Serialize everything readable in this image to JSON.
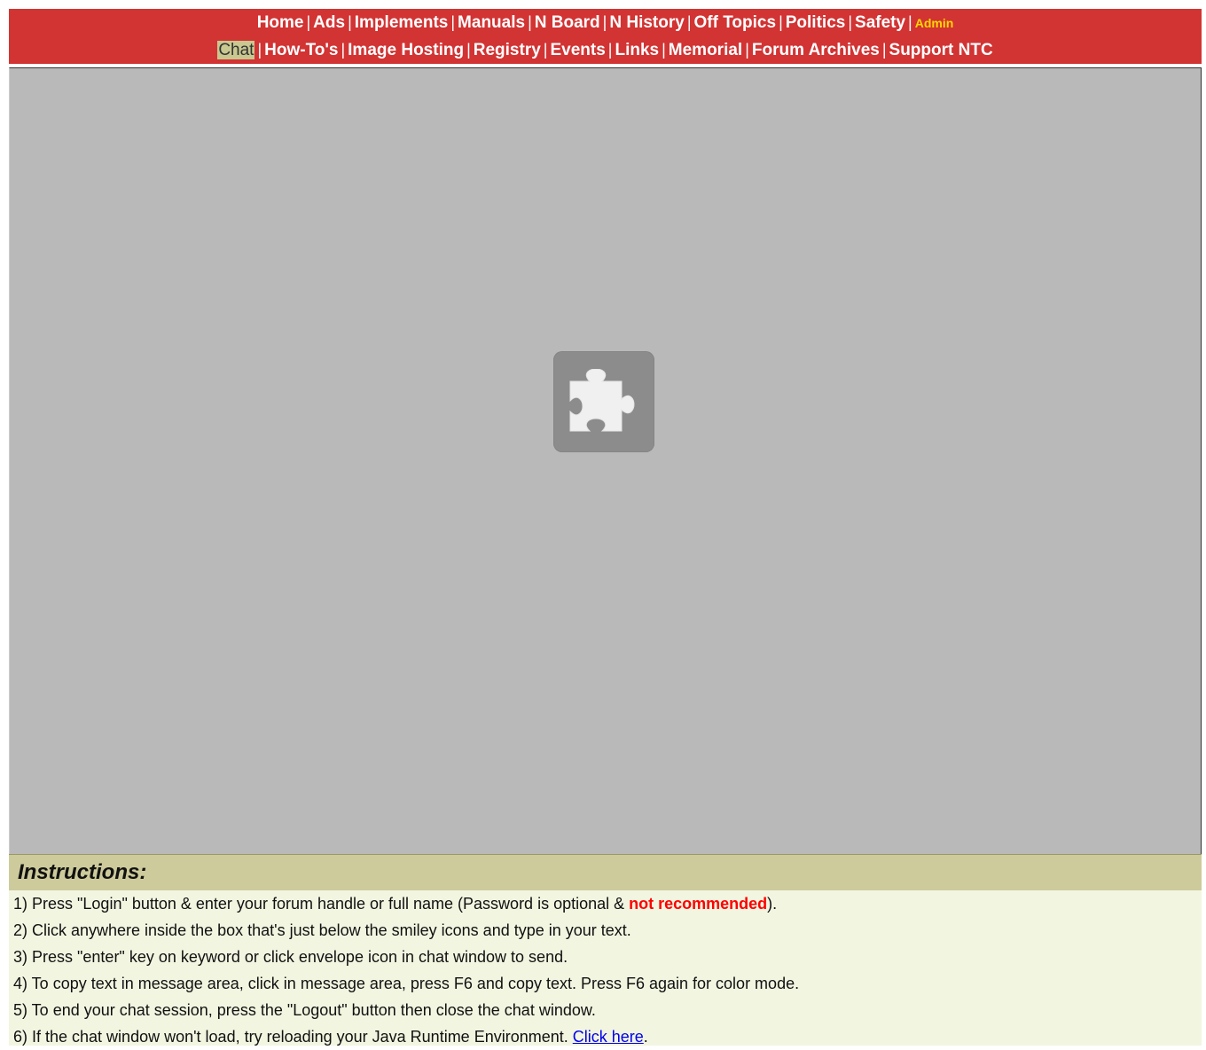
{
  "nav": {
    "row1": [
      "Home",
      "Ads",
      "Implements",
      "Manuals",
      "N Board",
      "N History",
      "Off Topics",
      "Politics",
      "Safety"
    ],
    "admin": "Admin",
    "current": "Chat",
    "row2": [
      "How-To's",
      "Image Hosting",
      "Registry",
      "Events",
      "Links",
      "Memorial",
      "Forum Archives",
      "Support NTC"
    ],
    "separator": "|"
  },
  "plugin": {
    "icon": "puzzle-piece-icon"
  },
  "instructions": {
    "title": "Instructions:",
    "line1_before": "1) Press \"Login\" button & enter your forum handle or full name (Password is optional & ",
    "line1_warning": "not recommended",
    "line1_after": ").",
    "line2": "2) Click anywhere inside the box that's just below the smiley icons and type in your text.",
    "line3": "3) Press \"enter\" key on keyword or click envelope icon in chat window to send.",
    "line4": "4) To copy text in message area, click in message area, press F6 and copy text. Press F6 again for color mode.",
    "line5": "5) To end your chat session, press the \"Logout\" button then close the chat window.",
    "line6_before": "6) If the chat window won't load, try reloading your Java Runtime Environment. ",
    "line6_link": "Click here",
    "line6_after": "."
  },
  "colors": {
    "nav_bg": "#d23333",
    "admin": "#ffd700",
    "plugin_bg": "#b9b9b9",
    "instr_header_bg": "#cdcb9b",
    "instr_body_bg": "#f2f5e0",
    "warning": "#ff0000",
    "link": "#0000ee"
  }
}
